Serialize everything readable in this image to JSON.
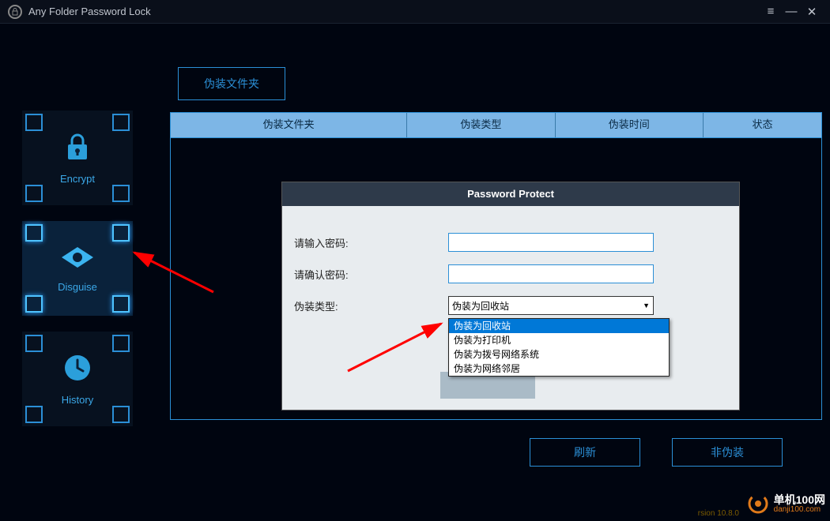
{
  "titlebar": {
    "title": "Any Folder Password Lock"
  },
  "sidebar": {
    "items": [
      {
        "label": "Encrypt"
      },
      {
        "label": "Disguise"
      },
      {
        "label": "History"
      }
    ]
  },
  "topButton": {
    "label": "伪装文件夹"
  },
  "tableHeaders": {
    "col1": "伪装文件夹",
    "col2": "伪装类型",
    "col3": "伪装时间",
    "col4": "状态"
  },
  "dialog": {
    "title": "Password Protect",
    "passwordLabel": "请输入密码:",
    "confirmLabel": "请确认密码:",
    "typeLabel": "伪装类型:",
    "selectedValue": "伪装为回收站",
    "options": [
      "伪装为回收站",
      "伪装为打印机",
      "伪装为拨号网络系统",
      "伪装为网络邻居"
    ]
  },
  "bottomButtons": {
    "refresh": "刷新",
    "undisguise": "非伪装"
  },
  "version": "rsion 10.8.0",
  "watermark": {
    "line1": "单机100网",
    "line2": "danji100.com"
  }
}
